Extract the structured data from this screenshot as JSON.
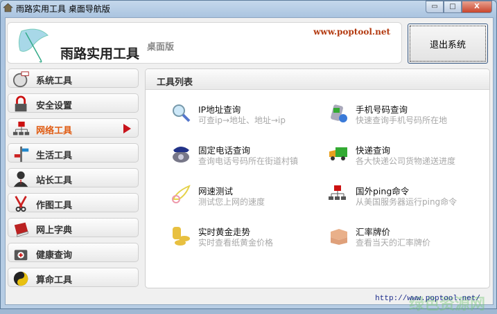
{
  "window": {
    "title": "雨路实用工具 桌面导航版",
    "controls": {
      "minimize": "▭",
      "maximize": "□",
      "close": "X"
    }
  },
  "header": {
    "brand": "雨路实用工具",
    "edition": "桌面版",
    "site": "www.poptool.net",
    "exit_label": "退出系统"
  },
  "sidebar": {
    "items": [
      {
        "label": "系统工具",
        "icon": "clock-flag-icon"
      },
      {
        "label": "安全设置",
        "icon": "lock-icon"
      },
      {
        "label": "网络工具",
        "icon": "network-icon",
        "active": true
      },
      {
        "label": "生活工具",
        "icon": "signpost-icon"
      },
      {
        "label": "站长工具",
        "icon": "user-icon"
      },
      {
        "label": "作图工具",
        "icon": "scissors-icon"
      },
      {
        "label": "网上字典",
        "icon": "book-icon"
      },
      {
        "label": "健康查询",
        "icon": "medkit-icon"
      },
      {
        "label": "算命工具",
        "icon": "yinyang-icon"
      }
    ]
  },
  "panel": {
    "title": "工具列表",
    "tools": [
      {
        "title": "IP地址查询",
        "desc": "可查ip→地址、地址→ip",
        "icon": "magnifier-icon"
      },
      {
        "title": "手机号码查询",
        "desc": "快速查询手机号码所在地",
        "icon": "mobile-phone-icon"
      },
      {
        "title": "固定电话查询",
        "desc": "查询电话号码所在街道村镇",
        "icon": "telephone-icon"
      },
      {
        "title": "快递查询",
        "desc": "各大快递公司货物递送进度",
        "icon": "truck-icon"
      },
      {
        "title": "网速测试",
        "desc": "测试您上网的速度",
        "icon": "wing-icon"
      },
      {
        "title": "国外ping命令",
        "desc": "从美国服务器运行ping命令",
        "icon": "network-icon"
      },
      {
        "title": "实时黄金走势",
        "desc": "实时查看纸黄金价格",
        "icon": "gold-coins-icon"
      },
      {
        "title": "汇率牌价",
        "desc": "查看当天的汇率牌价",
        "icon": "boxes-icon"
      }
    ]
  },
  "status": {
    "link": "http://www.poptool.net/"
  },
  "watermark": "绿色资源网",
  "colors": {
    "active": "#e05a10",
    "site": "#b33a10",
    "arrow": "#c8141c"
  }
}
